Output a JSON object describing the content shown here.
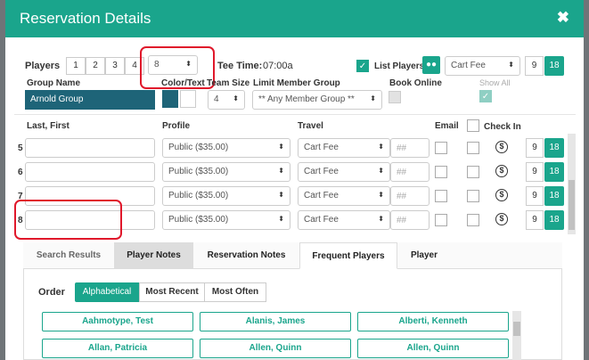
{
  "header": {
    "title": "Reservation Details",
    "close_label": "✖"
  },
  "players": {
    "label": "Players",
    "counts": [
      "1",
      "2",
      "3",
      "4"
    ],
    "selected": "8",
    "tee_time_label": "Tee Time:",
    "tee_time": "07:00a",
    "list_players_label": "List Players",
    "fee_select": "Cart Fee",
    "hole_9": "9",
    "hole_18": "18"
  },
  "group": {
    "name_label": "Group Name",
    "name_value": "Arnold Group",
    "color_label": "Color/Text",
    "team_size_label": "Team Size",
    "team_size_value": "4",
    "limit_label": "Limit Member Group",
    "limit_value": "** Any Member Group **",
    "book_online_label": "Book Online",
    "show_all_label": "Show All"
  },
  "columns": {
    "last_first": "Last, First",
    "profile": "Profile",
    "travel": "Travel",
    "email": "Email",
    "check_in": "Check In"
  },
  "rows": [
    {
      "num": "5",
      "name": "",
      "profile": "Public ($35.00)",
      "travel": "Cart Fee",
      "holes": "##",
      "h9": "9",
      "h18": "18"
    },
    {
      "num": "6",
      "name": "",
      "profile": "Public ($35.00)",
      "travel": "Cart Fee",
      "holes": "##",
      "h9": "9",
      "h18": "18"
    },
    {
      "num": "7",
      "name": "",
      "profile": "Public ($35.00)",
      "travel": "Cart Fee",
      "holes": "##",
      "h9": "9",
      "h18": "18"
    },
    {
      "num": "8",
      "name": "",
      "profile": "Public ($35.00)",
      "travel": "Cart Fee",
      "holes": "##",
      "h9": "9",
      "h18": "18"
    }
  ],
  "tabs": [
    "Search Results",
    "Player Notes",
    "Reservation Notes",
    "Frequent Players",
    "Player"
  ],
  "order": {
    "label": "Order",
    "options": [
      "Alphabetical",
      "Most Recent",
      "Most Often"
    ]
  },
  "frequent_players": [
    [
      "Aahmotype, Test",
      "Alanis, James",
      "Alberti, Kenneth"
    ],
    [
      "Allan, Patricia",
      "Allen, Quinn",
      "Allen, Quinn"
    ]
  ],
  "colors": {
    "accent": "#1aa58c",
    "group_swatch": "#1e6478",
    "highlight": "#e0182b"
  }
}
